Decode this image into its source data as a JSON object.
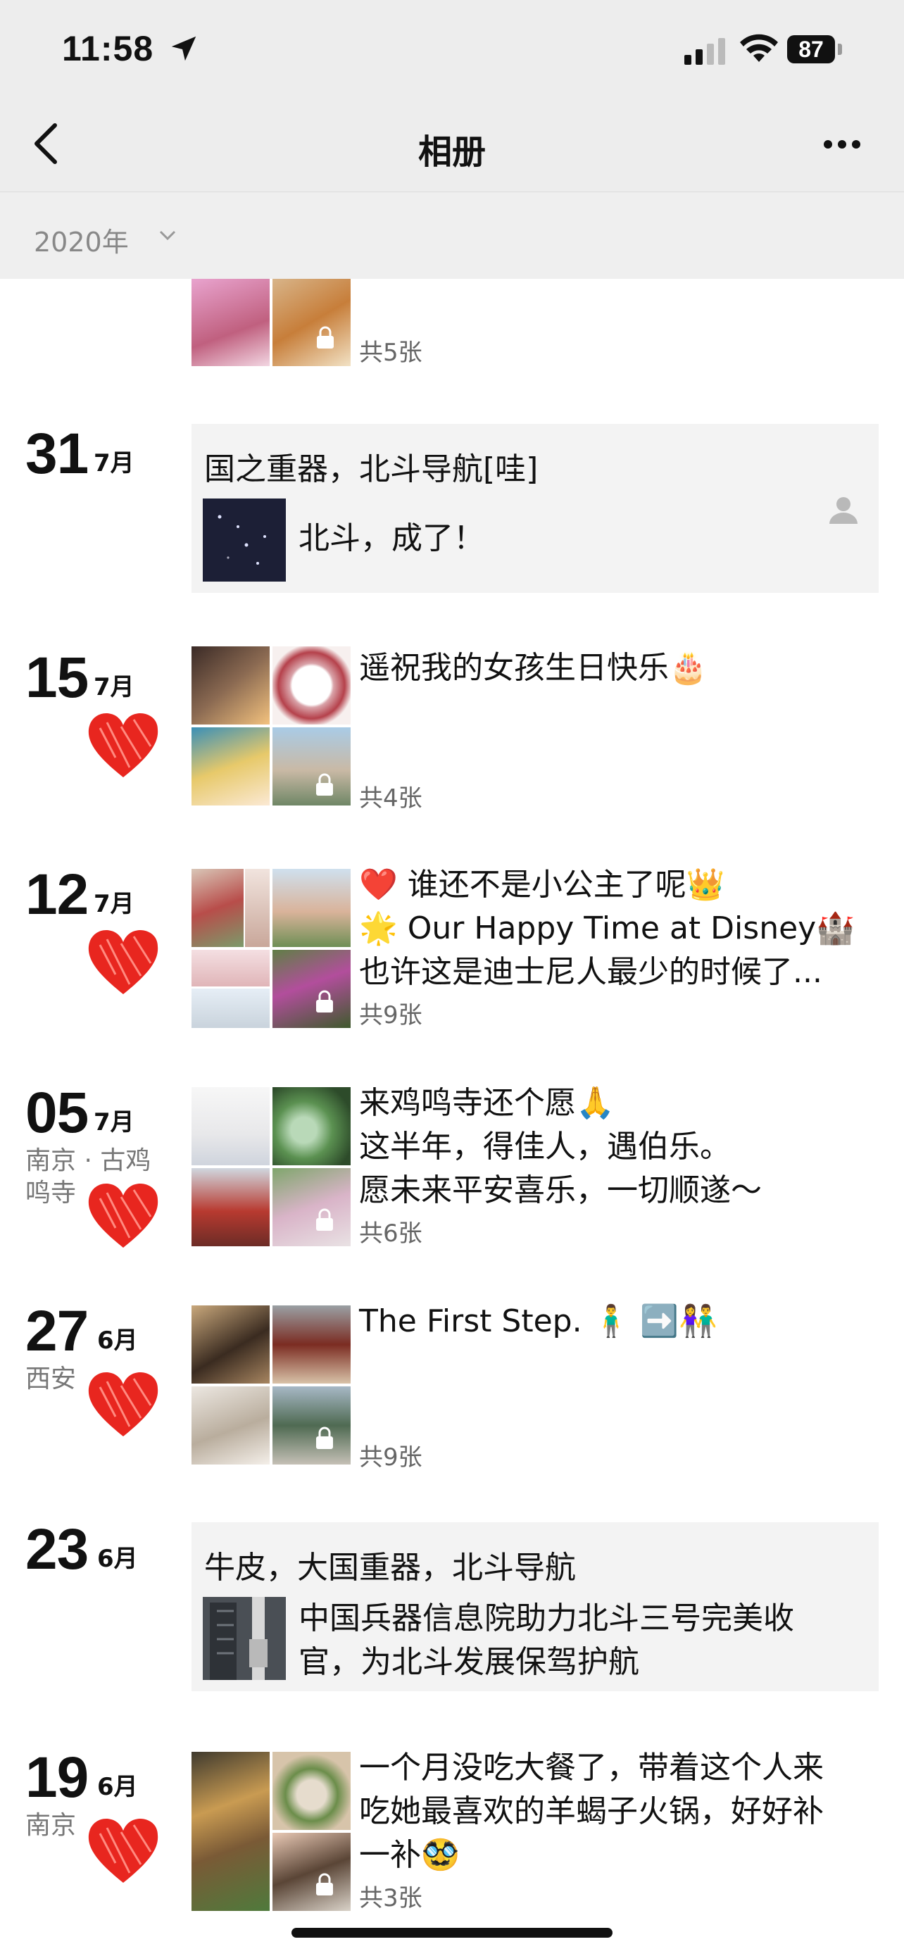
{
  "status": {
    "time": "11:58",
    "battery": "87"
  },
  "nav": {
    "title": "相册"
  },
  "year_filter": {
    "label": "2020年"
  },
  "top_partial": {
    "count": "共5张"
  },
  "entries": [
    {
      "day": "31",
      "month": "7月",
      "type": "share",
      "title": "国之重器，北斗导航[哇]",
      "text": "北斗，成了！"
    },
    {
      "day": "15",
      "month": "7月",
      "type": "photos",
      "caption": "遥祝我的女孩生日快乐🎂",
      "count": "共4张"
    },
    {
      "day": "12",
      "month": "7月",
      "type": "photos",
      "caption_lines": [
        "❤️ 谁还不是小公主了呢👑",
        "🌟 Our Happy Time at Disney🏰",
        "也许这是迪士尼人最少的时候了..."
      ],
      "count": "共9张"
    },
    {
      "day": "05",
      "month": "7月",
      "place": "南京 · 古鸡鸣寺",
      "type": "photos",
      "caption_lines": [
        "来鸡鸣寺还个愿🙏",
        "这半年，得佳人，遇伯乐。",
        "愿未来平安喜乐，一切顺遂～"
      ],
      "count": "共6张"
    },
    {
      "day": "27",
      "month": "6月",
      "place": "西安",
      "type": "photos",
      "caption": "The First Step. 🧍‍♂️ ➡️👫",
      "count": "共9张"
    },
    {
      "day": "23",
      "month": "6月",
      "type": "share",
      "title": "牛皮，大国重器，北斗导航",
      "text_lines": [
        "中国兵器信息院助力北斗三号完美收",
        "官，为北斗发展保驾护航"
      ]
    },
    {
      "day": "19",
      "month": "6月",
      "place": "南京",
      "type": "photos",
      "caption_lines": [
        "一个月没吃大餐了，带着这个人来",
        "吃她最喜欢的羊蝎子火锅，好好补",
        "一补🥸"
      ],
      "count": "共3张"
    }
  ]
}
